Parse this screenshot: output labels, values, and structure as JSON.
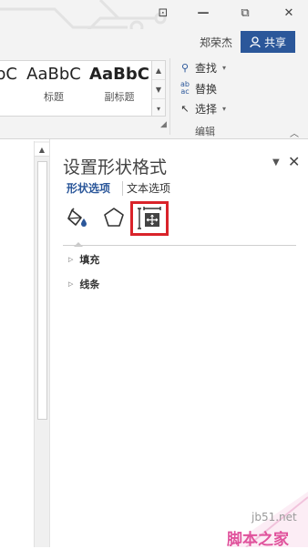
{
  "window": {
    "restore_down_glyph": "⧉",
    "close_glyph": "✕",
    "ribbon_display_glyph": "⊡"
  },
  "account": {
    "user_name": "郑荣杰",
    "share_label": "共享",
    "share_icon": "person-icon"
  },
  "ribbon": {
    "styles": [
      {
        "sample": "bC",
        "name": ""
      },
      {
        "sample": "AaBbC",
        "name": "标题"
      },
      {
        "sample": "AaBbC",
        "name": "副标题"
      }
    ],
    "gallery_scroll": [
      "▲",
      "▼",
      "▾"
    ],
    "editing": {
      "find_label": "查找",
      "replace_label": "替换",
      "select_label": "选择",
      "group_label": "编辑"
    }
  },
  "pane": {
    "title": "设置形状格式",
    "tabs": [
      "形状选项",
      "文本选项"
    ],
    "active_tab": "形状选项",
    "categories": [
      "fill-line-icon",
      "effects-pentagon-icon",
      "layout-properties-icon"
    ],
    "sections": [
      "填充",
      "线条"
    ],
    "accent_color": "#2b579a",
    "highlight_color": "#d9232a"
  },
  "watermark": {
    "url": "jb51.net",
    "site": "脚本之家"
  }
}
